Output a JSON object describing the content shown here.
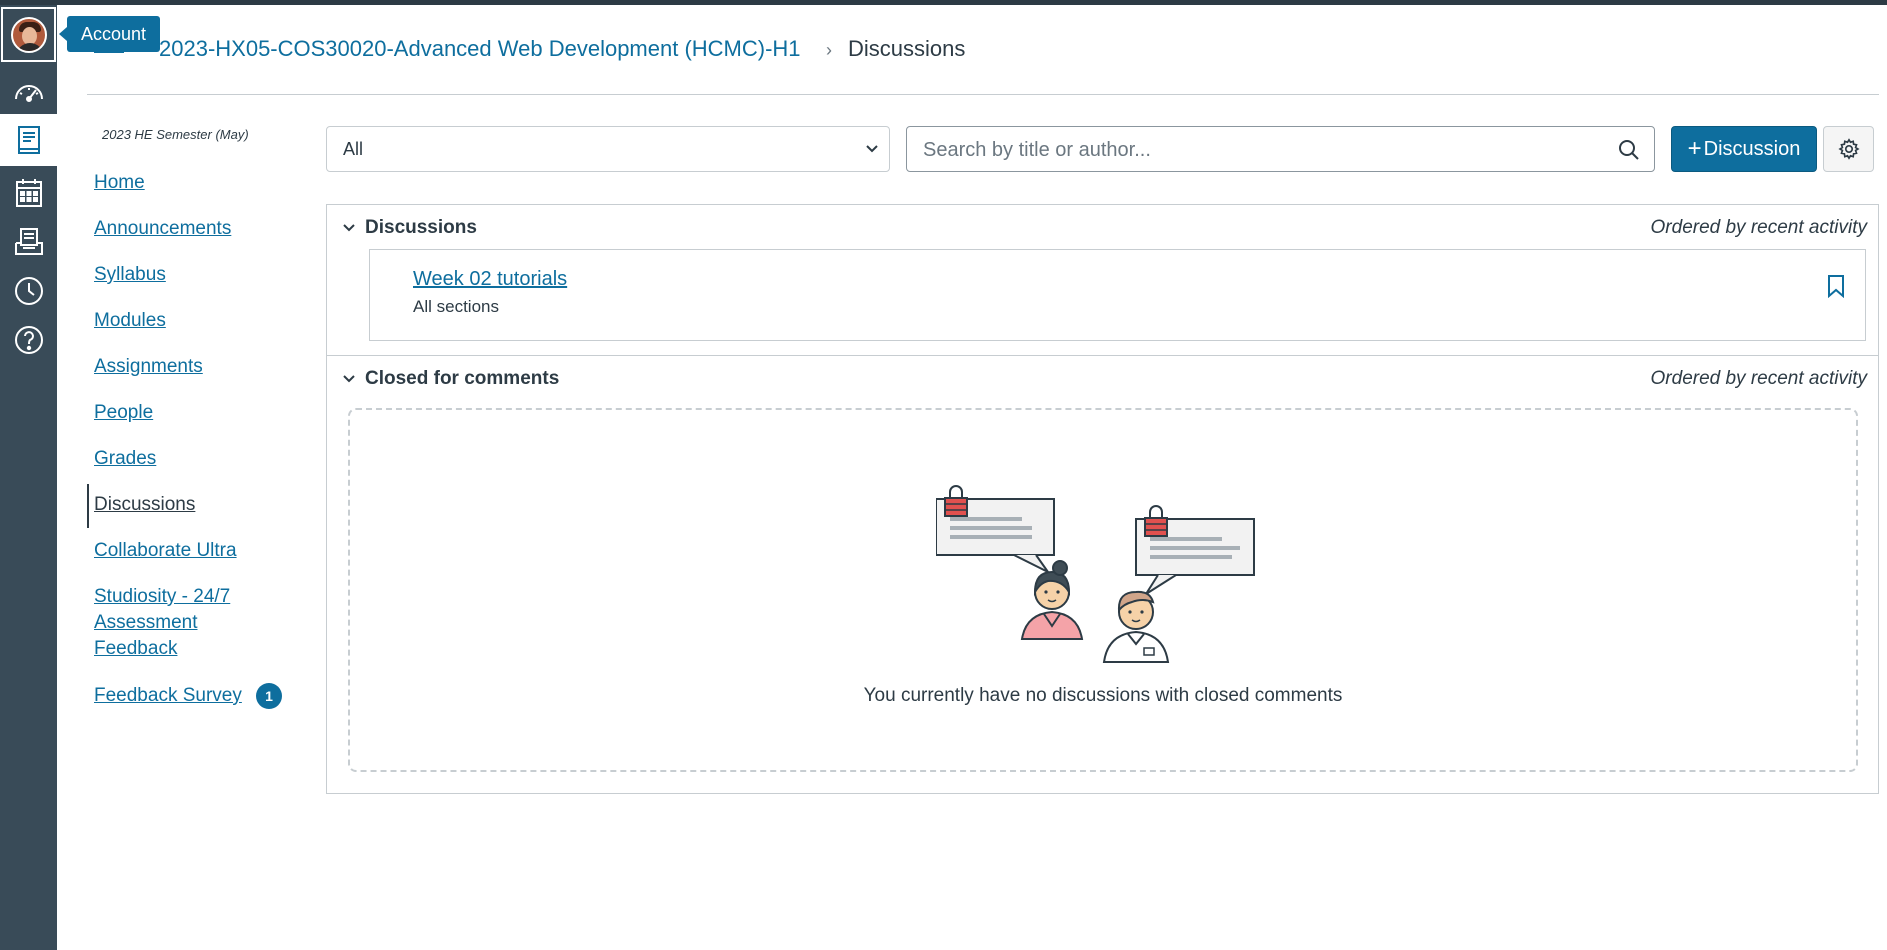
{
  "global_nav": {
    "tooltip": "Account",
    "items": [
      {
        "icon": "avatar-icon"
      },
      {
        "icon": "dashboard-icon"
      },
      {
        "icon": "courses-icon"
      },
      {
        "icon": "calendar-icon"
      },
      {
        "icon": "inbox-icon"
      },
      {
        "icon": "history-icon"
      },
      {
        "icon": "help-icon"
      }
    ],
    "active_index": 2
  },
  "breadcrumb": {
    "course": "2023-HX05-COS30020-Advanced Web Development (HCMC)-H1",
    "separator": "›",
    "current": "Discussions"
  },
  "course_nav": {
    "term": "2023 HE Semester (May)",
    "items": [
      {
        "label": "Home"
      },
      {
        "label": "Announcements"
      },
      {
        "label": "Syllabus"
      },
      {
        "label": "Modules"
      },
      {
        "label": "Assignments"
      },
      {
        "label": "People"
      },
      {
        "label": "Grades"
      },
      {
        "label": "Discussions"
      },
      {
        "label": "Collaborate Ultra"
      },
      {
        "label": "Studiosity - 24/7 Assessment Feedback"
      },
      {
        "label": "Feedback Survey",
        "badge": "1"
      }
    ],
    "active": "Discussions"
  },
  "toolbar": {
    "filter_value": "All",
    "search_placeholder": "Search by title or author...",
    "add_button_label": "Discussion",
    "add_button_prefix": "+"
  },
  "sections": {
    "discussions": {
      "title": "Discussions",
      "order": "Ordered by recent activity",
      "items": [
        {
          "title": "Week 02 tutorials",
          "subtitle": "All sections"
        }
      ]
    },
    "closed": {
      "title": "Closed for comments",
      "order": "Ordered by recent activity",
      "empty_message": "You currently have no discussions with closed comments"
    }
  },
  "colors": {
    "brand": "#0e6e9e",
    "nav_bg": "#394b58",
    "text": "#2d3b45",
    "border": "#c7cdd1"
  }
}
